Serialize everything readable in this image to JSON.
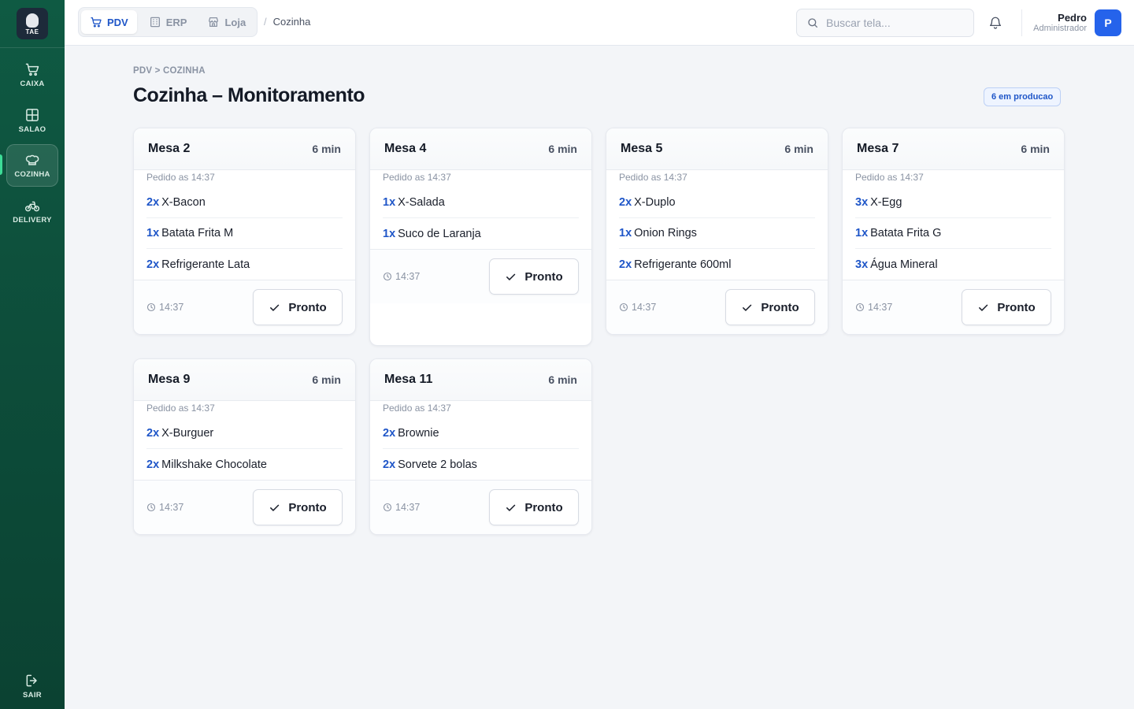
{
  "brand": {
    "logo_text": "TAE"
  },
  "sidebar": {
    "items": [
      {
        "label": "CAIXA",
        "icon": "cart-icon"
      },
      {
        "label": "SALAO",
        "icon": "grid-icon"
      },
      {
        "label": "COZINHA",
        "icon": "chef-hat-icon",
        "active": true
      },
      {
        "label": "DELIVERY",
        "icon": "bicycle-icon"
      }
    ],
    "logout_label": "SAIR"
  },
  "topbar": {
    "modules": [
      {
        "label": "PDV",
        "icon": "cart-icon",
        "active": true
      },
      {
        "label": "ERP",
        "icon": "building-icon"
      },
      {
        "label": "Loja",
        "icon": "store-icon"
      }
    ],
    "current_page": "Cozinha",
    "search_placeholder": "Buscar tela...",
    "user": {
      "name": "Pedro",
      "role": "Administrador",
      "initial": "P"
    }
  },
  "main": {
    "breadcrumb": "PDV > COZINHA",
    "title": "Cozinha – Monitoramento",
    "badge": "6 em producao",
    "orders": [
      {
        "mesa": "Mesa 2",
        "elapsed": "6 min",
        "pedido": "Pedido as 14:37",
        "time": "14:37",
        "action": "Pronto",
        "items": [
          {
            "qty": "2x",
            "name": "X-Bacon"
          },
          {
            "qty": "1x",
            "name": "Batata Frita M"
          },
          {
            "qty": "2x",
            "name": "Refrigerante Lata"
          }
        ]
      },
      {
        "mesa": "Mesa 4",
        "elapsed": "6 min",
        "pedido": "Pedido as 14:37",
        "time": "14:37",
        "action": "Pronto",
        "items": [
          {
            "qty": "1x",
            "name": "X-Salada"
          },
          {
            "qty": "1x",
            "name": "Suco de Laranja"
          }
        ]
      },
      {
        "mesa": "Mesa 5",
        "elapsed": "6 min",
        "pedido": "Pedido as 14:37",
        "time": "14:37",
        "action": "Pronto",
        "items": [
          {
            "qty": "2x",
            "name": "X-Duplo"
          },
          {
            "qty": "1x",
            "name": "Onion Rings"
          },
          {
            "qty": "2x",
            "name": "Refrigerante 600ml"
          }
        ]
      },
      {
        "mesa": "Mesa 7",
        "elapsed": "6 min",
        "pedido": "Pedido as 14:37",
        "time": "14:37",
        "action": "Pronto",
        "items": [
          {
            "qty": "3x",
            "name": "X-Egg"
          },
          {
            "qty": "1x",
            "name": "Batata Frita G"
          },
          {
            "qty": "3x",
            "name": "Água Mineral"
          }
        ]
      },
      {
        "mesa": "Mesa 9",
        "elapsed": "6 min",
        "pedido": "Pedido as 14:37",
        "time": "14:37",
        "action": "Pronto",
        "items": [
          {
            "qty": "2x",
            "name": "X-Burguer"
          },
          {
            "qty": "2x",
            "name": "Milkshake Chocolate"
          }
        ]
      },
      {
        "mesa": "Mesa 11",
        "elapsed": "6 min",
        "pedido": "Pedido as 14:37",
        "time": "14:37",
        "action": "Pronto",
        "items": [
          {
            "qty": "2x",
            "name": "Brownie"
          },
          {
            "qty": "2x",
            "name": "Sorvete 2 bolas"
          }
        ]
      }
    ]
  },
  "colors": {
    "sidebar": "#0f5a43",
    "accent": "#1f56c8",
    "active_indicator": "#3ddc97",
    "avatar": "#2563eb"
  }
}
